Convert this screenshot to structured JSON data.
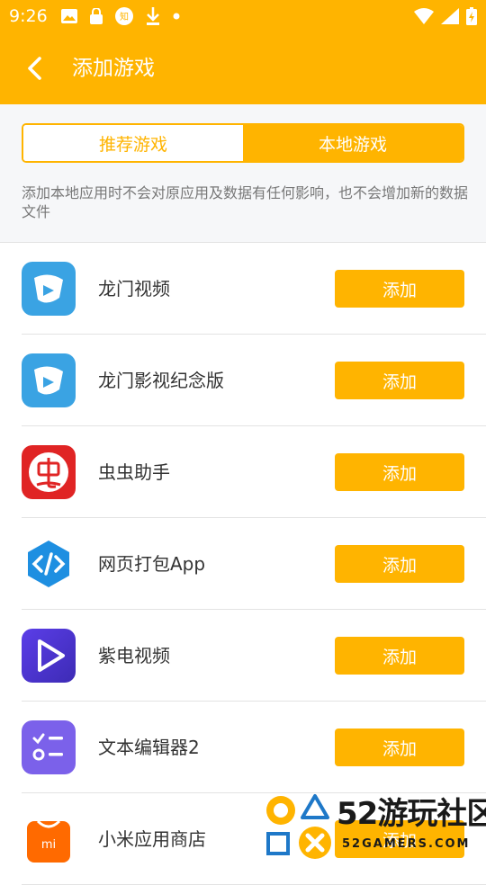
{
  "status_bar": {
    "time": "9:26"
  },
  "header": {
    "title": "添加游戏"
  },
  "tabs": [
    {
      "label": "推荐游戏",
      "selected": false
    },
    {
      "label": "本地游戏",
      "selected": true
    }
  ],
  "notice": "添加本地应用时不会对原应用及数据有任何影响，也不会增加新的数据文件",
  "apps": [
    {
      "name": "龙门视频",
      "icon": "longmen-video-icon",
      "button": "添加"
    },
    {
      "name": "龙门影视纪念版",
      "icon": "longmen-video-icon",
      "button": "添加"
    },
    {
      "name": "虫虫助手",
      "icon": "chongchong-icon",
      "button": "添加"
    },
    {
      "name": "网页打包App",
      "icon": "code-brackets-icon",
      "button": "添加"
    },
    {
      "name": "紫电视频",
      "icon": "play-triangle-icon",
      "button": "添加"
    },
    {
      "name": "文本编辑器2",
      "icon": "checklist-icon",
      "button": "添加"
    },
    {
      "name": "小米应用商店",
      "icon": "mi-bag-icon",
      "button": "添加"
    }
  ],
  "watermark": {
    "brand": "52游玩社区",
    "domain": "52GAMERS.COM"
  },
  "colors": {
    "accent": "#ffb400",
    "background": "#f6f7f9"
  }
}
